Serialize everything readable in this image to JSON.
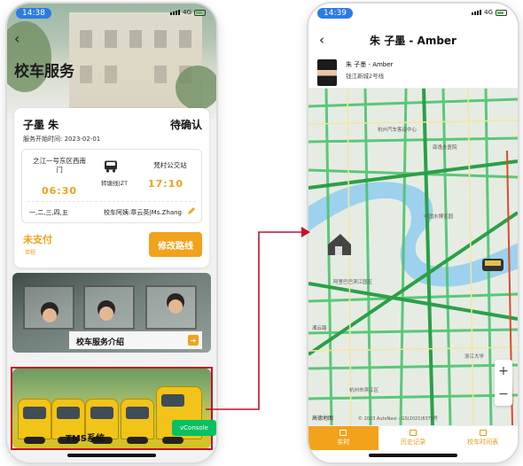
{
  "left": {
    "status": {
      "time": "14:38",
      "network": "4G"
    },
    "title": "校车服务",
    "card": {
      "student_name": "子墨 朱",
      "status": "待确认",
      "start_date": "服务开始时间: 2023-02-01",
      "from_stop": "之江一号东区西南门",
      "to_stop": "梵村公交站",
      "departure_time": "06:30",
      "arrival_time": "17:10",
      "line": "转塘线|ZT",
      "weekdays": "一,二,三,四,五",
      "attendant": "校车阿姨:章云英|Ms.Zhang",
      "payment_status": "未支付",
      "payment_sub": "单程",
      "modify_button": "修改路线"
    },
    "promo_intro": {
      "label": "校车服务介绍"
    },
    "promo_tms": {
      "label": "TMS系统"
    },
    "vconsole": "vConsole"
  },
  "right": {
    "status": {
      "time": "14:39",
      "network": "4G"
    },
    "title": "朱 子墨 - Amber",
    "student": {
      "name": "朱 子墨 - Amber",
      "school": "钱江新城2号线"
    },
    "map": {
      "places": [
        "杭州汽车客运中心",
        "邵逸夫医院",
        "中国水博览园",
        "阿里巴巴滨江园区",
        "浙江大学",
        "杭州市滨江区",
        "湘云路"
      ],
      "logo": "高德地图",
      "copyright": "© 2023 AutoNavi - GS(2021)6375号",
      "zoom_in": "+",
      "zoom_out": "−"
    },
    "tabs": [
      {
        "label": "实时",
        "active": true
      },
      {
        "label": "历史记录",
        "active": false
      },
      {
        "label": "校车时间表",
        "active": false
      }
    ]
  },
  "colors": {
    "accent": "#f3a21c",
    "highlight": "#c1132a",
    "status_pill": "#2b7be4",
    "vconsole": "#07c160"
  }
}
